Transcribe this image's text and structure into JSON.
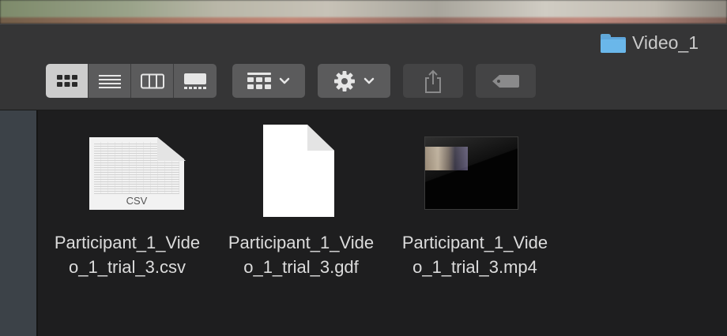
{
  "window": {
    "title": "Video_1",
    "title_icon": "folder-icon",
    "folder_color": "#6ab7ea"
  },
  "toolbar": {
    "view_modes": [
      {
        "name": "icon-view",
        "icon": "grid-icon",
        "active": true
      },
      {
        "name": "list-view",
        "icon": "list-icon",
        "active": false
      },
      {
        "name": "column-view",
        "icon": "columns-icon",
        "active": false
      },
      {
        "name": "gallery-view",
        "icon": "gallery-icon",
        "active": false
      }
    ],
    "group_button_icon": "group-grid-icon",
    "action_button_icon": "gear-icon",
    "share_button_icon": "share-icon",
    "tag_button_icon": "tag-icon"
  },
  "files": [
    {
      "name_line1": "Participant_1_Vide",
      "name_line2": "o_1_trial_3.csv",
      "kind": "csv",
      "badge": "CSV"
    },
    {
      "name_line1": "Participant_1_Vide",
      "name_line2": "o_1_trial_3.gdf",
      "kind": "document"
    },
    {
      "name_line1": "Participant_1_Vide",
      "name_line2": "o_1_trial_3.mp4",
      "kind": "video"
    }
  ]
}
